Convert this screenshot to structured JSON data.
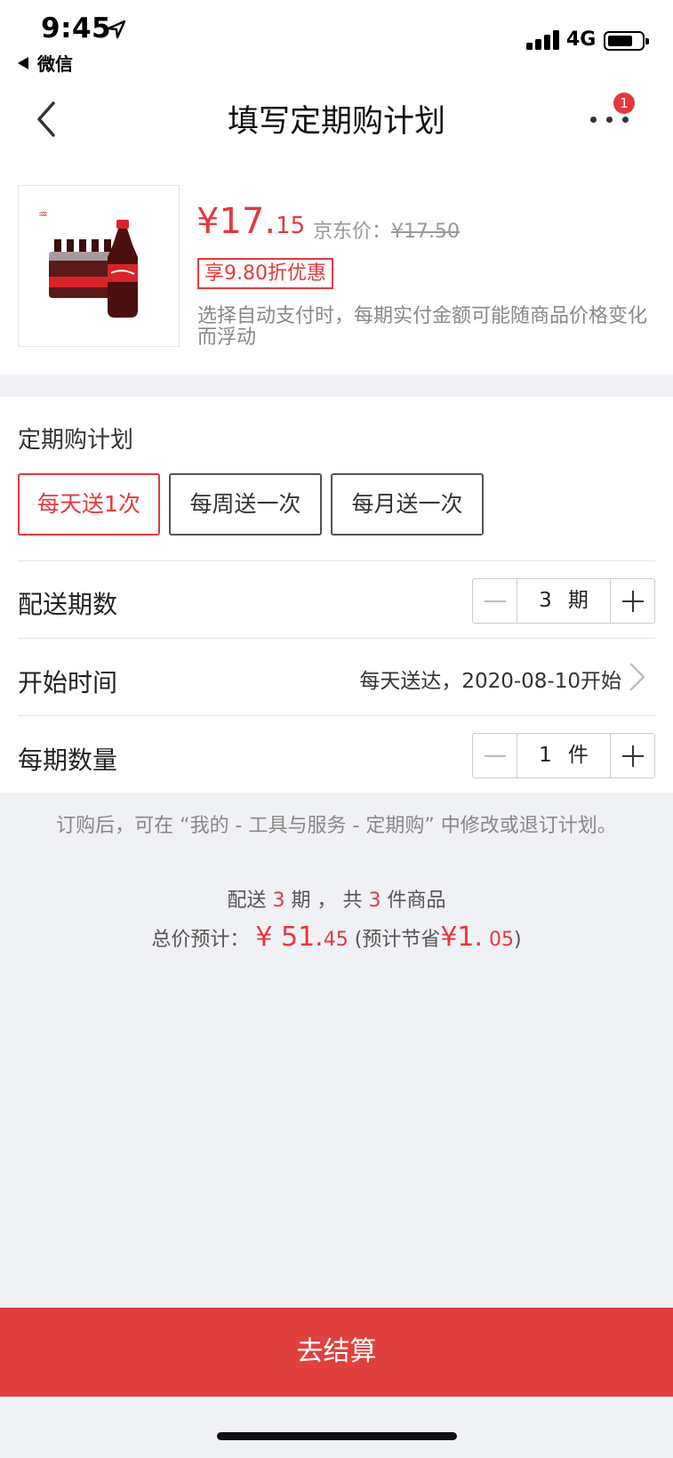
{
  "status": {
    "time": "9:45",
    "back_app": "微信",
    "network": "4G"
  },
  "nav": {
    "title": "填写定期购计划",
    "badge_count": "1"
  },
  "product": {
    "price_main": "¥17.",
    "price_decimal": "15",
    "jd_price_label": "京东价：",
    "jd_price": "¥17.50",
    "discount_tag": "享9.80折优惠",
    "note": "选择自动支付时，每期实付金额可能随商品价格变化而浮动"
  },
  "plan": {
    "title": "定期购计划",
    "options": [
      "每天送1次",
      "每周送一次",
      "每月送一次"
    ],
    "selected_option": "每天送1次"
  },
  "rows": {
    "periods": {
      "label": "配送期数",
      "value": "3",
      "unit": "期"
    },
    "start_time": {
      "label": "开始时间",
      "value": "每天送达，2020-08-10开始"
    },
    "quantity": {
      "label": "每期数量",
      "value": "1",
      "unit": "件"
    }
  },
  "hint": "订购后，可在 “我的 - 工具与服务 - 定期购” 中修改或退订计划。",
  "summary": {
    "deliver_prefix": "配送",
    "periods": "3",
    "mid": "期 ， 共",
    "items": "3",
    "suffix": "件商品",
    "total_label": "总价预计：",
    "total_main": "¥ 51.",
    "total_decimal": "45",
    "save_prefix": "(预计节省",
    "save_main": "¥1.",
    "save_decimal": "05",
    "save_suffix": ")"
  },
  "checkout_label": "去结算",
  "colors": {
    "accent": "#e4393c",
    "checkout_bg": "#e0403e",
    "page_bg": "#f0f1f5"
  }
}
